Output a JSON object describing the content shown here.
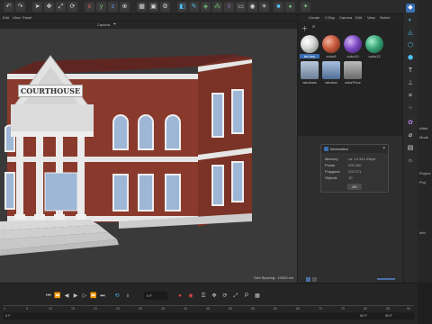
{
  "menubar": {
    "items": [
      "Edit",
      "View",
      "Panel"
    ],
    "viewport_label": "Camera"
  },
  "viewport": {
    "building_sign": "COURTHOUSE",
    "grid_spacing": "Grid Spacing : 10000 cm"
  },
  "material_manager": {
    "menu": [
      "Create",
      "V-Ray",
      "Camera",
      "Edit",
      "View",
      "Select"
    ],
    "materials": [
      {
        "label": "brt-key",
        "color": "#d9d9d9",
        "selected": true
      },
      {
        "label": "color6",
        "color": "#c85a3c",
        "selected": false
      },
      {
        "label": "color10",
        "color": "#7e4bc4",
        "selected": false
      },
      {
        "label": "color12",
        "color": "#3aa578",
        "selected": false
      },
      {
        "label": "windows",
        "color": "#8fa3b8",
        "selected": false
      },
      {
        "label": "window",
        "color": "#6f8fb5",
        "selected": false
      },
      {
        "label": "colorFloor",
        "color": "#9a9a9a",
        "selected": false
      }
    ]
  },
  "info_dialog": {
    "title": "Information",
    "rows": [
      {
        "label": "Memory",
        "value": "ca. 14 344 KByte"
      },
      {
        "label": "Points",
        "value": "205 280"
      },
      {
        "label": "Polygons",
        "value": "203 271"
      },
      {
        "label": "Objects",
        "value": "10"
      }
    ],
    "ok_label": "OK"
  },
  "timeline": {
    "current_frame": "0 F",
    "end_frame": "90 F",
    "start_field": "0 F",
    "ruler_ticks": [
      "0",
      "5",
      "10",
      "15",
      "20",
      "25",
      "30",
      "35",
      "40",
      "45",
      "50",
      "55",
      "60",
      "65",
      "70",
      "75",
      "80",
      "85",
      "90"
    ]
  },
  "attributes": {
    "labels": [
      "Attrib",
      "Mode",
      "Project",
      "Proj",
      "Info"
    ]
  }
}
